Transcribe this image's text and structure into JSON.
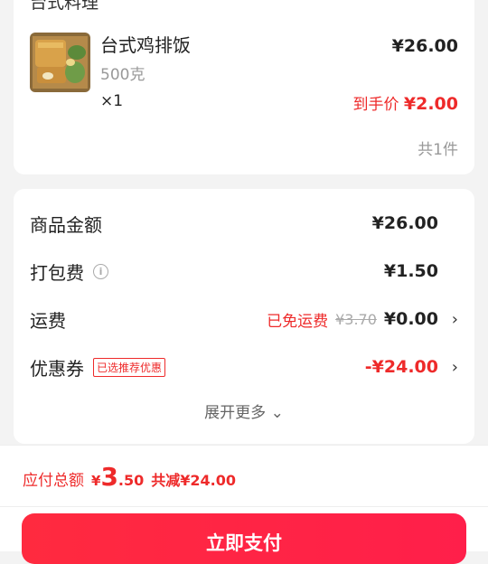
{
  "shop": {
    "name": "台式料理"
  },
  "item": {
    "name": "台式鸡排饭",
    "spec": "500克",
    "qty": "×1",
    "price": "¥26.00",
    "final_label": "到手价",
    "final_price": "¥2.00",
    "count": "共1件"
  },
  "fees": {
    "goods": {
      "label": "商品金额",
      "value": "¥26.00"
    },
    "packing": {
      "label": "打包费",
      "value": "¥1.50",
      "icon": "info-icon"
    },
    "shipping": {
      "label": "运费",
      "tag": "已免运费",
      "original": "¥3.70",
      "value": "¥0.00"
    },
    "coupon": {
      "label": "优惠券",
      "badge": "已选推荐优惠",
      "value": "-¥24.00"
    },
    "expand": "展开更多"
  },
  "footer": {
    "total_label": "应付总额",
    "currency": "¥",
    "amount_int": "3",
    "amount_dec": ".50",
    "saved": "共减¥24.00",
    "pay_button": "立即支付"
  },
  "colors": {
    "accent": "#ee2a2a",
    "button": "#ff2a3f"
  }
}
